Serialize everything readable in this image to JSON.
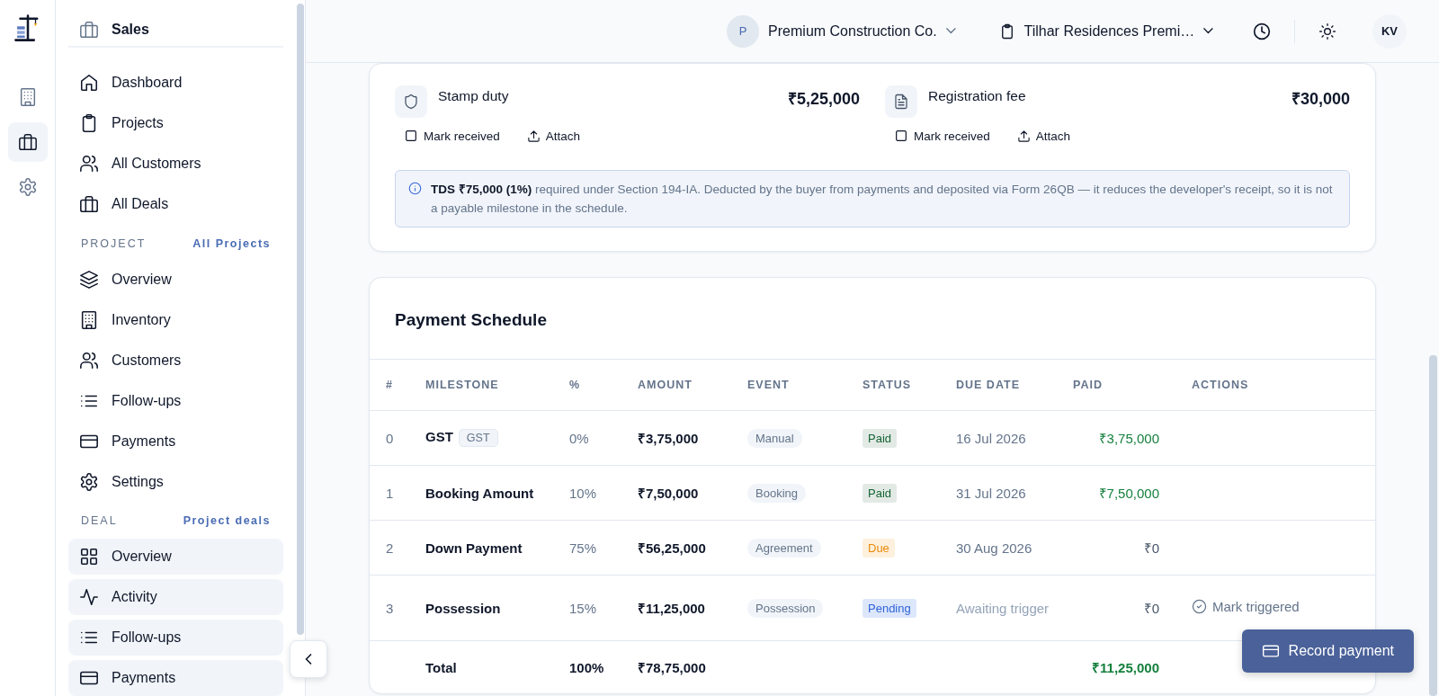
{
  "rail": {
    "items": [
      {
        "kind": "building",
        "selected": false
      },
      {
        "kind": "briefcase",
        "selected": true
      },
      {
        "kind": "gear",
        "selected": false
      }
    ]
  },
  "sidebar": {
    "title": "Sales",
    "items": [
      {
        "label": "Dashboard",
        "kind": "home",
        "highlighted": false
      },
      {
        "label": "Projects",
        "kind": "clipboard",
        "highlighted": false
      },
      {
        "label": "All Customers",
        "kind": "users",
        "highlighted": false
      },
      {
        "label": "All Deals",
        "kind": "briefcase",
        "highlighted": false
      }
    ],
    "sections": [
      {
        "label": "PROJECT",
        "link": "All Projects",
        "items": [
          {
            "label": "Overview",
            "kind": "layers",
            "highlighted": false
          },
          {
            "label": "Inventory",
            "kind": "building",
            "highlighted": false
          },
          {
            "label": "Customers",
            "kind": "users",
            "highlighted": false
          },
          {
            "label": "Follow-ups",
            "kind": "list",
            "highlighted": false
          },
          {
            "label": "Payments",
            "kind": "card",
            "highlighted": false
          },
          {
            "label": "Settings",
            "kind": "gear",
            "highlighted": false
          }
        ]
      },
      {
        "label": "DEAL",
        "link": "Project deals",
        "items": [
          {
            "label": "Overview",
            "kind": "grid",
            "highlighted": true
          },
          {
            "label": "Activity",
            "kind": "activity",
            "highlighted": true
          },
          {
            "label": "Follow-ups",
            "kind": "list",
            "highlighted": true
          },
          {
            "label": "Payments",
            "kind": "card",
            "highlighted": true
          }
        ]
      }
    ]
  },
  "header": {
    "company": {
      "initial": "P",
      "name": "Premium Construction Co."
    },
    "project": {
      "name": "Tilhar Residences Premi…"
    },
    "user_initials": "KV"
  },
  "statutory": {
    "items": [
      {
        "kind": "shield",
        "name": "Stamp duty",
        "amount": "₹5,25,000",
        "received": false,
        "mark_label": "Mark received",
        "attach_label": "Attach"
      },
      {
        "kind": "file",
        "name": "Registration fee",
        "amount": "₹30,000",
        "received": false,
        "mark_label": "Mark received",
        "attach_label": "Attach"
      }
    ],
    "note": "**TDS ₹75,000 (1%)** required under Section 194-IA. Deducted by the buyer from payments and deposited via Form 26QB — it reduces the developer's receipt, so it is not a payable milestone in the schedule."
  },
  "schedule": {
    "title": "Payment Schedule",
    "columns": [
      "#",
      "MILESTONE",
      "%",
      "AMOUNT",
      "EVENT",
      "STATUS",
      "DUE DATE",
      "PAID",
      "ACTIONS"
    ],
    "rows": [
      {
        "index": "0",
        "milestone": "GST",
        "tag": "GST",
        "percent": "0%",
        "amount": "₹3,75,000",
        "event": "Manual",
        "status": "Paid",
        "kind": "paid",
        "due_date": "16 Jul 2026",
        "awaiting": false,
        "paid": "₹3,75,000",
        "paid_received": true
      },
      {
        "index": "1",
        "milestone": "Booking Amount",
        "percent": "10%",
        "amount": "₹7,50,000",
        "event": "Booking",
        "status": "Paid",
        "kind": "paid",
        "due_date": "31 Jul 2026",
        "awaiting": false,
        "paid": "₹7,50,000",
        "paid_received": true
      },
      {
        "index": "2",
        "milestone": "Down Payment",
        "percent": "75%",
        "amount": "₹56,25,000",
        "event": "Agreement",
        "status": "Due",
        "kind": "due",
        "due_date": "30 Aug 2026",
        "awaiting": false,
        "paid": "₹0",
        "paid_received": false
      },
      {
        "index": "3",
        "milestone": "Possession",
        "percent": "15%",
        "amount": "₹11,25,000",
        "event": "Possession",
        "status": "Pending",
        "kind": "pending",
        "due_date": "Awaiting trigger",
        "awaiting": true,
        "paid": "₹0",
        "paid_received": false,
        "action": "Mark triggered"
      }
    ],
    "total": {
      "label": "Total",
      "percent": "100%",
      "amount": "₹78,75,000",
      "paid": "₹11,25,000"
    }
  },
  "record_button": "Record payment"
}
